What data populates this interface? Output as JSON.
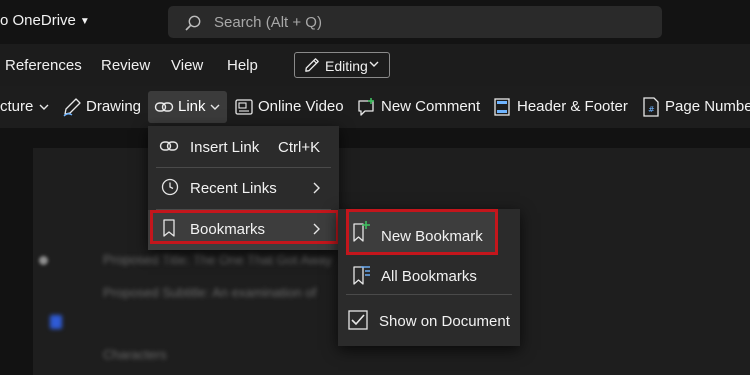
{
  "titlebar": {
    "title": "o OneDrive",
    "search_placeholder": "Search (Alt + Q)"
  },
  "menubar": {
    "items": [
      "References",
      "Review",
      "View",
      "Help"
    ],
    "editing_label": "Editing"
  },
  "ribbon": {
    "picture_partial": "cture",
    "drawing": "Drawing",
    "link": "Link",
    "online_video": "Online Video",
    "new_comment": "New Comment",
    "header_footer": "Header & Footer",
    "page_numbers_partial": "Page Numbe"
  },
  "link_menu": {
    "insert_link": "Insert Link",
    "insert_link_shortcut": "Ctrl+K",
    "recent_links": "Recent Links",
    "bookmarks": "Bookmarks"
  },
  "bookmarks_menu": {
    "new_bookmark": "New Bookmark",
    "all_bookmarks": "All Bookmarks",
    "show_on_document": "Show on Document",
    "show_on_document_checked": true
  },
  "document": {
    "line1": "Proposed Title: The One That Got Away",
    "line2": "Proposed Subtitle: An examination of",
    "line3": "Characters"
  },
  "colors": {
    "highlight_border": "#c4161c",
    "menu_bg": "#2b2b2b",
    "accent_icon": "#6fb4ff"
  }
}
